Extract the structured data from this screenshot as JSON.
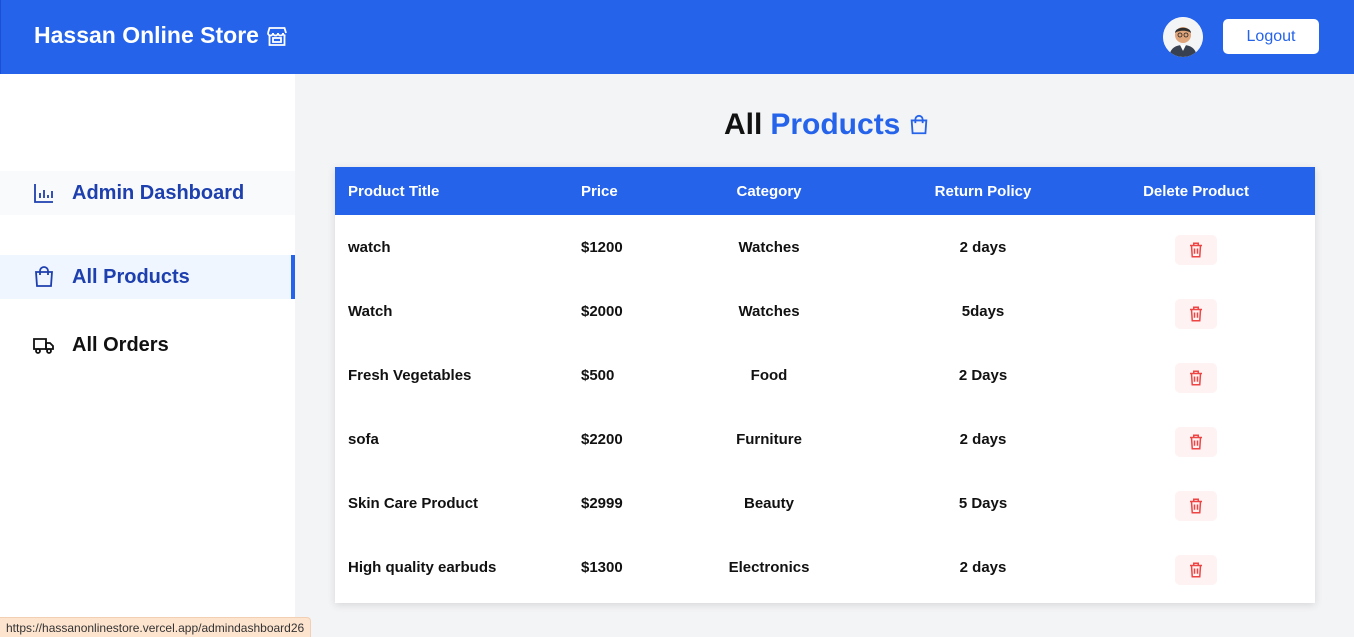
{
  "header": {
    "brand": "Hassan Online Store",
    "brand_icon": "store-icon",
    "logout_label": "Logout"
  },
  "sidebar": {
    "items": [
      {
        "label": "Admin Dashboard",
        "icon": "chart-icon"
      },
      {
        "label": "All Products",
        "icon": "shopping-bag-icon",
        "active": true
      },
      {
        "label": "All Orders",
        "icon": "truck-icon"
      }
    ]
  },
  "main": {
    "title_part1": "All",
    "title_part2": "Products",
    "columns": [
      "Product Title",
      "Price",
      "Category",
      "Return Policy",
      "Delete Product"
    ],
    "rows": [
      {
        "title": "watch",
        "price": "$1200",
        "category": "Watches",
        "return": "2 days"
      },
      {
        "title": "Watch",
        "price": "$2000",
        "category": "Watches",
        "return": "5days"
      },
      {
        "title": "Fresh Vegetables",
        "price": "$500",
        "category": "Food",
        "return": "2 Days"
      },
      {
        "title": "sofa",
        "price": "$2200",
        "category": "Furniture",
        "return": "2 days"
      },
      {
        "title": "Skin Care Product",
        "price": "$2999",
        "category": "Beauty",
        "return": "5 Days"
      },
      {
        "title": "High quality earbuds",
        "price": "$1300",
        "category": "Electronics",
        "return": "2 days"
      }
    ]
  },
  "status_url": "https://hassanonlinestore.vercel.app/admindashboard26",
  "colors": {
    "primary": "#2563eb",
    "nav_active_text": "#1e40af",
    "delete_icon": "#ef4444",
    "delete_bg": "#fef2f2"
  }
}
